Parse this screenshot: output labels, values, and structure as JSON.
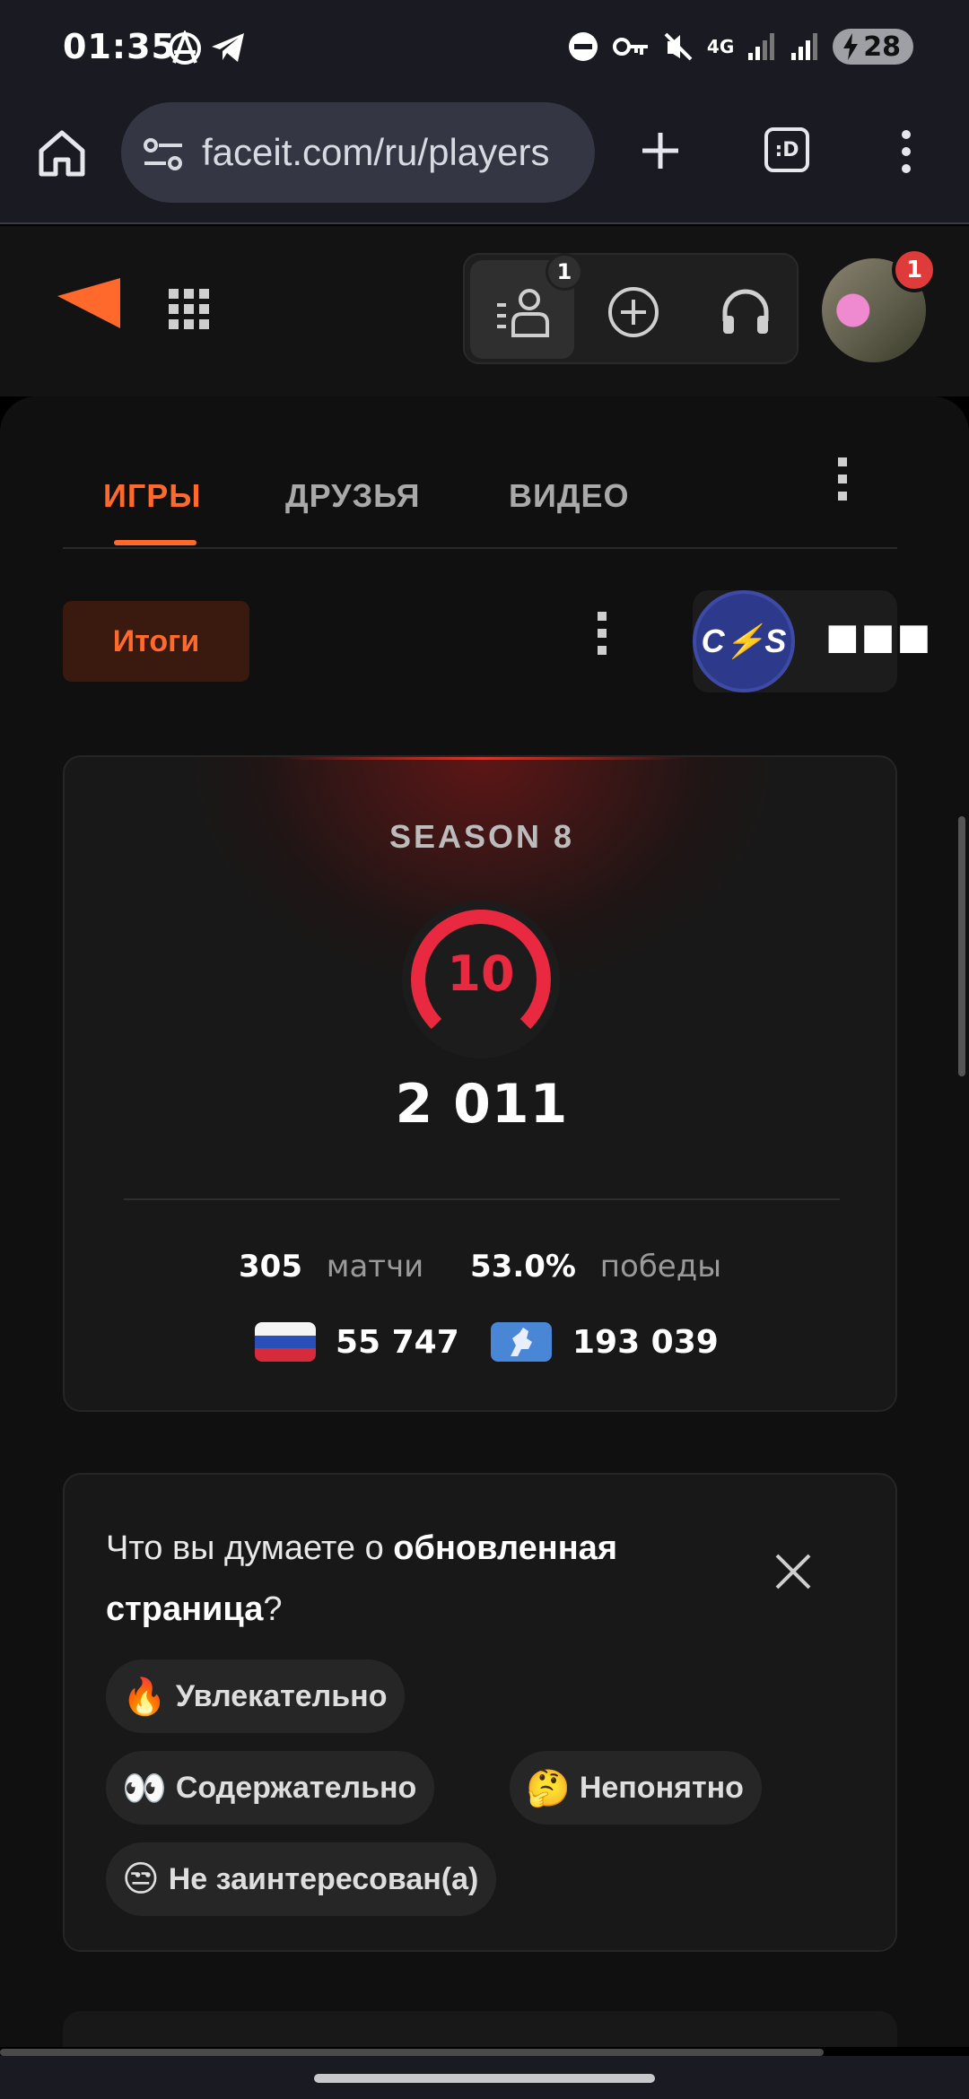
{
  "status_bar": {
    "time": "01:35",
    "network": "4G",
    "battery": "28"
  },
  "browser": {
    "url": "faceit.com/ru/players",
    "tabs_icon_label": ":D"
  },
  "header": {
    "friends_badge": "1",
    "avatar_badge": "1"
  },
  "tabs": [
    {
      "label": "ИГРЫ",
      "active": true
    },
    {
      "label": "ДРУЗЬЯ",
      "active": false
    },
    {
      "label": "ВИДЕО",
      "active": false
    }
  ],
  "summary": {
    "button_label": "Итоги",
    "game_logo": "C⚡S"
  },
  "stats": {
    "season": "SEASON 8",
    "level": "10",
    "elo": "2 011",
    "matches_value": "305",
    "matches_label": "матчи",
    "winrate_value": "53.0%",
    "winrate_label": "победы",
    "country_rank": "55 747",
    "region_rank": "193 039"
  },
  "feedback": {
    "question_prefix": "Что вы думаете о ",
    "question_bold": "обновленная страница",
    "question_suffix": "?",
    "options": [
      {
        "emoji": "🔥",
        "label": "Увлекательно"
      },
      {
        "emoji": "👀",
        "label": "Содержательно"
      },
      {
        "emoji": "🤔",
        "label": "Непонятно"
      },
      {
        "emoji": "😒",
        "label": "Не заинтересован(а)"
      }
    ]
  },
  "colors": {
    "accent": "#ff6a2c",
    "level": "#e8293f",
    "background": "#101010"
  }
}
